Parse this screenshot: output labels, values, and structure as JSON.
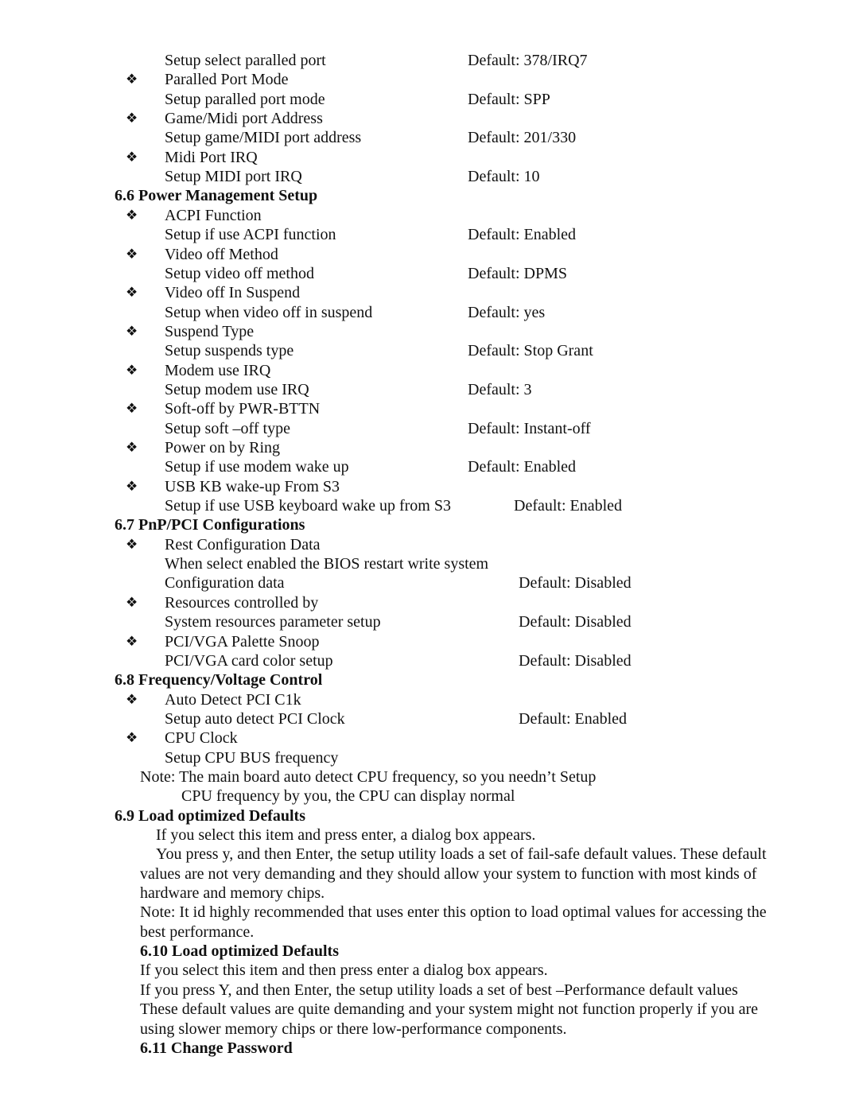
{
  "bullet_glyph": "❖",
  "lines": [
    {
      "type": "desc",
      "text": "Setup select paralled port",
      "default": "Default: 378/IRQ7",
      "dcol": 588
    },
    {
      "type": "item",
      "text": "Paralled Port Mode"
    },
    {
      "type": "desc",
      "text": "Setup paralled port mode",
      "default": "Default: SPP",
      "dcol": 588
    },
    {
      "type": "item",
      "text": "Game/Midi port Address"
    },
    {
      "type": "desc",
      "text": "Setup game/MIDI port address",
      "default": "Default: 201/330",
      "dcol": 588
    },
    {
      "type": "item",
      "text": "Midi Port IRQ"
    },
    {
      "type": "desc",
      "text": "Setup MIDI port IRQ",
      "default": "Default: 10",
      "dcol": 588
    },
    {
      "type": "heading",
      "text": "6.6 Power Management Setup"
    },
    {
      "type": "item",
      "text": "ACPI Function"
    },
    {
      "type": "desc",
      "text": "Setup if use ACPI function",
      "default": "Default: Enabled",
      "dcol": 588
    },
    {
      "type": "item",
      "text": "Video off Method"
    },
    {
      "type": "desc",
      "text": "Setup video off method",
      "default": "Default: DPMS",
      "dcol": 588
    },
    {
      "type": "item",
      "text": "Video off In Suspend"
    },
    {
      "type": "desc",
      "text": "Setup when video off in suspend",
      "default": "Default: yes",
      "dcol": 588
    },
    {
      "type": "item",
      "text": "Suspend Type"
    },
    {
      "type": "desc",
      "text": "Setup suspends type",
      "default": "Default: Stop Grant",
      "dcol": 588
    },
    {
      "type": "item",
      "text": "Modem use IRQ"
    },
    {
      "type": "desc",
      "text": "Setup modem use IRQ",
      "default": "Default: 3",
      "dcol": 588
    },
    {
      "type": "item",
      "text": "Soft-off by PWR-BTTN"
    },
    {
      "type": "desc",
      "text": "Setup soft –off type",
      "default": "Default: Instant-off",
      "dcol": 588
    },
    {
      "type": "item",
      "text": "Power on by Ring"
    },
    {
      "type": "desc",
      "text": "Setup if use modem wake up",
      "default": "Default: Enabled",
      "dcol": 588
    },
    {
      "type": "item",
      "text": "USB KB wake-up From S3"
    },
    {
      "type": "desc",
      "text": "Setup if use USB keyboard wake up from S3",
      "default": "Default: Enabled",
      "dcol": 646
    },
    {
      "type": "heading",
      "text": "6.7 PnP/PCI Configurations"
    },
    {
      "type": "item",
      "text": "Rest Configuration Data"
    },
    {
      "type": "desc",
      "text": "When select enabled the BIOS restart write system",
      "default": "",
      "dcol": 652
    },
    {
      "type": "desc",
      "text": "Configuration data",
      "default": "Default: Disabled",
      "dcol": 652
    },
    {
      "type": "item",
      "text": "Resources controlled by"
    },
    {
      "type": "desc",
      "text": "System resources parameter setup",
      "default": "Default: Disabled",
      "dcol": 652
    },
    {
      "type": "item",
      "text": "PCI/VGA Palette Snoop"
    },
    {
      "type": "desc",
      "text": "PCI/VGA card color setup",
      "default": "Default: Disabled",
      "dcol": 652
    },
    {
      "type": "heading",
      "text": "6.8 Frequency/Voltage Control"
    },
    {
      "type": "item",
      "text": "Auto Detect PCI C1k"
    },
    {
      "type": "desc",
      "text": "Setup auto detect PCI Clock",
      "default": "Default: Enabled",
      "dcol": 652
    },
    {
      "type": "item",
      "text": "CPU Clock"
    },
    {
      "type": "desc",
      "text": "Setup CPU BUS frequency",
      "default": "",
      "dcol": 652
    },
    {
      "type": "note",
      "text": "Note: The main board auto detect CPU frequency, so you needn’t Setup"
    },
    {
      "type": "note2",
      "text": "CPU frequency by you, the CPU can display normal"
    },
    {
      "type": "heading",
      "text": "6.9 Load optimized Defaults"
    },
    {
      "type": "para-ind",
      "text": "If you select this item and press enter, a dialog box appears."
    },
    {
      "type": "para-ind",
      "text": "You press y, and then Enter, the setup utility loads a set of fail-safe default values. These default"
    },
    {
      "type": "para",
      "text": "values are not very demanding and they should allow your system to function with most kinds of"
    },
    {
      "type": "para",
      "text": "hardware and memory chips."
    },
    {
      "type": "para",
      "text": "Note: It id highly recommended that uses enter this option to load optimal values for accessing the"
    },
    {
      "type": "para",
      "text": "best performance."
    },
    {
      "type": "heading2",
      "text": "6.10  Load optimized Defaults"
    },
    {
      "type": "para",
      "text": "If you select this item and then press enter a dialog box appears."
    },
    {
      "type": "para",
      "text": "If you press Y, and then Enter, the setup utility loads a set of best –Performance default values"
    },
    {
      "type": "para",
      "text": "These default values are quite demanding and your system might not function properly if you are"
    },
    {
      "type": "para",
      "text": "using slower memory chips or there low-performance components."
    },
    {
      "type": "heading2",
      "text": "6.11  Change Password"
    }
  ]
}
